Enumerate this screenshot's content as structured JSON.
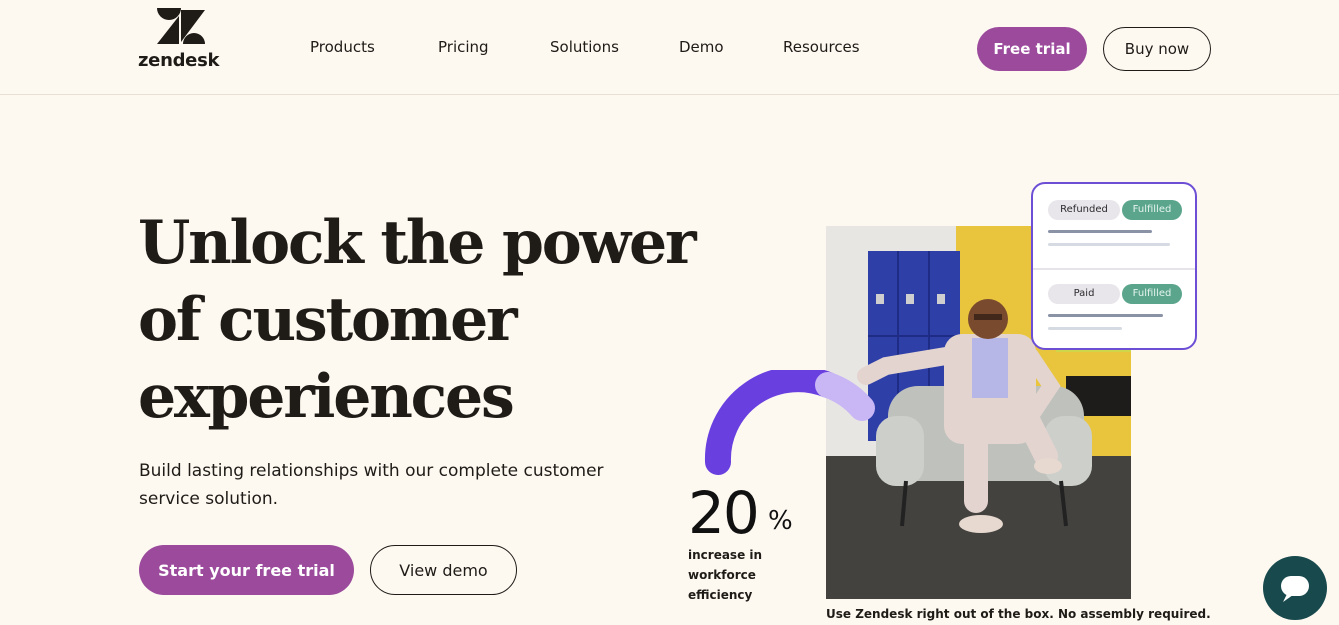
{
  "brand": {
    "name": "zendesk",
    "logo_icon": "zendesk-z-icon",
    "accent_color": "#9b4a9c",
    "text_color": "#1f1b17",
    "background_color": "#fdf9f1"
  },
  "nav": {
    "items": [
      {
        "label": "Products"
      },
      {
        "label": "Pricing"
      },
      {
        "label": "Solutions"
      },
      {
        "label": "Demo"
      },
      {
        "label": "Resources"
      }
    ],
    "free_trial_label": "Free trial",
    "buy_now_label": "Buy now"
  },
  "hero": {
    "headline_lines": [
      "Unlock the power",
      "of customer",
      "experiences"
    ],
    "subtext": "Build lasting relationships with our complete customer service solution.",
    "primary_cta": "Start your free trial",
    "secondary_cta": "View demo"
  },
  "stat": {
    "value": "20",
    "unit": "%",
    "description": "increase in workforce efficiency",
    "arc_color": "#6a3fe0"
  },
  "order_card": {
    "rows": [
      {
        "status": "Refunded",
        "fulfillment": "Fulfilled"
      },
      {
        "status": "Paid",
        "fulfillment": "Fulfilled"
      }
    ],
    "border_color": "#6d4fd6",
    "fulfilled_color": "#5aa58c"
  },
  "photo": {
    "caption": "Use Zendesk right out of the box. No assembly required."
  },
  "chat": {
    "icon": "chat-bubble-icon",
    "color": "#17494d"
  }
}
